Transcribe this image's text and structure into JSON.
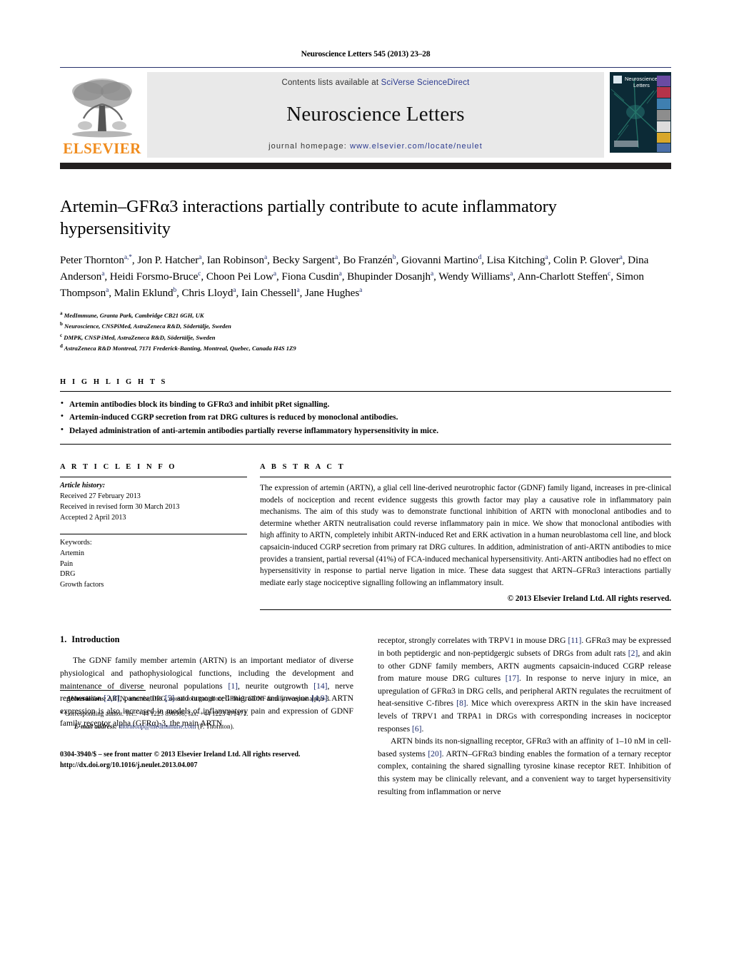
{
  "running_head": "Neuroscience Letters 545 (2013) 23–28",
  "banner": {
    "publisher_word": "ELSEVIER",
    "contents_prefix": "Contents lists available at ",
    "contents_link": "SciVerse ScienceDirect",
    "journal_title": "Neuroscience Letters",
    "homepage_prefix": "journal homepage: ",
    "homepage_url": "www.elsevier.com/locate/neulet",
    "cover_title_line1": "Neuroscience",
    "cover_title_line2": "Letters"
  },
  "article": {
    "title": "Artemin–GFRα3 interactions partially contribute to acute inflammatory hypersensitivity",
    "authors": [
      {
        "name": "Peter Thornton",
        "sup": "a,*"
      },
      {
        "name": "Jon P. Hatcher",
        "sup": "a"
      },
      {
        "name": "Ian Robinson",
        "sup": "a"
      },
      {
        "name": "Becky Sargent",
        "sup": "a"
      },
      {
        "name": "Bo Franzén",
        "sup": "b"
      },
      {
        "name": "Giovanni Martino",
        "sup": "d"
      },
      {
        "name": "Lisa Kitching",
        "sup": "a"
      },
      {
        "name": "Colin P. Glover",
        "sup": "a"
      },
      {
        "name": "Dina Anderson",
        "sup": "a"
      },
      {
        "name": "Heidi Forsmo-Bruce",
        "sup": "c"
      },
      {
        "name": "Choon Pei Low",
        "sup": "a"
      },
      {
        "name": "Fiona Cusdin",
        "sup": "a"
      },
      {
        "name": "Bhupinder Dosanjh",
        "sup": "a"
      },
      {
        "name": "Wendy Williams",
        "sup": "a"
      },
      {
        "name": "Ann-Charlott Steffen",
        "sup": "c"
      },
      {
        "name": "Simon Thompson",
        "sup": "a"
      },
      {
        "name": "Malin Eklund",
        "sup": "b"
      },
      {
        "name": "Chris Lloyd",
        "sup": "a"
      },
      {
        "name": "Iain Chessell",
        "sup": "a"
      },
      {
        "name": "Jane Hughes",
        "sup": "a"
      }
    ],
    "affiliations": [
      {
        "sup": "a",
        "text": "MedImmune, Granta Park, Cambridge CB21 6GH, UK"
      },
      {
        "sup": "b",
        "text": "Neuroscience, CNSPiMed, AstraZeneca R&D, Södertälje, Sweden"
      },
      {
        "sup": "c",
        "text": "DMPK, CNSP iMed, AstraZeneca R&D, Södertälje, Sweden"
      },
      {
        "sup": "d",
        "text": "AstraZeneca R&D Montreal, 7171 Frederick-Banting, Montreal, Quebec, Canada H4S 1Z9"
      }
    ]
  },
  "highlights": {
    "heading": "H I G H L I G H T S",
    "items": [
      "Artemin antibodies block its binding to GFRα3 and inhibit pRet signalling.",
      "Artemin-induced CGRP secretion from rat DRG cultures is reduced by monoclonal antibodies.",
      "Delayed administration of anti-artemin antibodies partially reverse inflammatory hypersensitivity in mice."
    ]
  },
  "article_info": {
    "heading": "A R T I C L E    I N F O",
    "history_label": "Article history:",
    "history": [
      "Received 27 February 2013",
      "Received in revised form 30 March 2013",
      "Accepted 2 April 2013"
    ],
    "keywords_label": "Keywords:",
    "keywords": [
      "Artemin",
      "Pain",
      "DRG",
      "Growth factors"
    ]
  },
  "abstract": {
    "heading": "A B S T R A C T",
    "body": "The expression of artemin (ARTN), a glial cell line-derived neurotrophic factor (GDNF) family ligand, increases in pre-clinical models of nociception and recent evidence suggests this growth factor may play a causative role in inflammatory pain mechanisms. The aim of this study was to demonstrate functional inhibition of ARTN with monoclonal antibodies and to determine whether ARTN neutralisation could reverse inflammatory pain in mice. We show that monoclonal antibodies with high affinity to ARTN, completely inhibit ARTN-induced Ret and ERK activation in a human neuroblastoma cell line, and block capsaicin-induced CGRP secretion from primary rat DRG cultures. In addition, administration of anti-ARTN antibodies to mice provides a transient, partial reversal (41%) of FCA-induced mechanical hypersensitivity. Anti-ARTN antibodies had no effect on hypersensitivity in response to partial nerve ligation in mice. These data suggest that ARTN–GFRα3 interactions partially mediate early stage nociceptive signalling following an inflammatory insult.",
    "copyright": "© 2013 Elsevier Ireland Ltd. All rights reserved."
  },
  "body": {
    "section_number": "1.",
    "section_title": "Introduction",
    "left_paragraph_parts": [
      {
        "t": "The GDNF family member artemin (ARTN) is an important mediator of diverse physiological and pathophysiological functions, including the development and maintenance of diverse neuronal populations "
      },
      {
        "t": "[1]",
        "ref": true
      },
      {
        "t": ", neurite outgrowth "
      },
      {
        "t": "[14]",
        "ref": true
      },
      {
        "t": ", nerve regeneration "
      },
      {
        "t": "[2,8]",
        "ref": true
      },
      {
        "t": ", pancreatitis "
      },
      {
        "t": "[5]",
        "ref": true
      },
      {
        "t": " and tumour cell migration and invasion "
      },
      {
        "t": "[4,9]",
        "ref": true
      },
      {
        "t": ". ARTN expression is also increased in models of inflammatory pain and expression of GDNF family receptor alpha (GFRα)-3, the main ARTN"
      }
    ],
    "right_paragraph1_parts": [
      {
        "t": "receptor, strongly correlates with TRPV1 in mouse DRG "
      },
      {
        "t": "[11]",
        "ref": true
      },
      {
        "t": ". GFRα3 may be expressed in both peptidergic and non-peptidgergic subsets of DRGs from adult rats "
      },
      {
        "t": "[2]",
        "ref": true
      },
      {
        "t": ", and akin to other GDNF family members, ARTN augments capsaicin-induced CGRP release from mature mouse DRG cultures "
      },
      {
        "t": "[17]",
        "ref": true
      },
      {
        "t": ". In response to nerve injury in mice, an upregulation of GFRα3 in DRG cells, and peripheral ARTN regulates the recruitment of heat-sensitive C-fibres "
      },
      {
        "t": "[8]",
        "ref": true
      },
      {
        "t": ". Mice which overexpress ARTN in the skin have increased levels of TRPV1 and TRPA1 in DRGs with corresponding increases in nociceptor responses "
      },
      {
        "t": "[6]",
        "ref": true
      },
      {
        "t": "."
      }
    ],
    "right_paragraph2_parts": [
      {
        "t": "ARTN binds its non-signalling receptor, GFRα3 with an affinity of 1–10 nM in cell-based systems "
      },
      {
        "t": "[20]",
        "ref": true
      },
      {
        "t": ". ARTN–GFRα3 binding enables the formation of a ternary receptor complex, containing the shared signalling tyrosine kinase receptor RET. Inhibition of this system may be clinically relevant, and a convenient way to target hypersensitivity resulting from inflammation or nerve"
      }
    ]
  },
  "footnotes": {
    "abbrev_label": "Abbreviations:",
    "abbrev_text": "ARTN, artemin; DRG, dorsal root ganglion; GFRα3, GDNF family receptor alpha-3.",
    "corresponding": "* Corresponding author. Tel.: +44 1223 898508; fax: +44 1223 471471.",
    "email_label": "E-mail address:",
    "email": "thorntonp@medimmune.com",
    "email_suffix": "(P. Thornton).",
    "issn_line": "0304-3940/$ – see front matter © 2013 Elsevier Ireland Ltd. All rights reserved.",
    "doi": "http://dx.doi.org/10.1016/j.neulet.2013.04.007"
  },
  "colors": {
    "rule_navy": "#24306a",
    "link_navy": "#2b3a8f",
    "elsevier_orange": "#F08C1E",
    "band_dark": "#221f1f",
    "banner_grey": "#e9e9e9"
  }
}
